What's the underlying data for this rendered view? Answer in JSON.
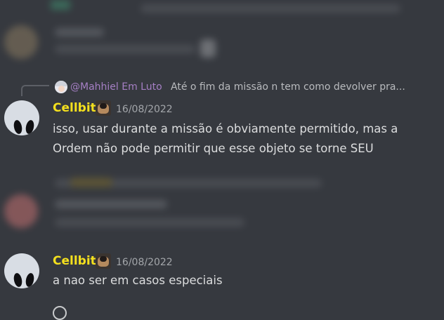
{
  "colors": {
    "background": "#36393f",
    "username": "#f4e01e",
    "mention": "#a57fc4",
    "text": "#dcddde",
    "timestamp": "#a3a6aa"
  },
  "reply": {
    "mention": "@Mahhiel Em Luto",
    "preview": "Até o fim da missão n tem como devolver pra..."
  },
  "messages": [
    {
      "username": "Cellbit",
      "timestamp": "16/08/2022",
      "lines": [
        "isso, usar durante a missão é obviamente permitido, mas a",
        "Ordem não pode permitir que esse objeto se torne SEU"
      ]
    },
    {
      "username": "Cellbit",
      "timestamp": "16/08/2022",
      "lines": [
        "a nao ser em casos especiais"
      ]
    }
  ]
}
